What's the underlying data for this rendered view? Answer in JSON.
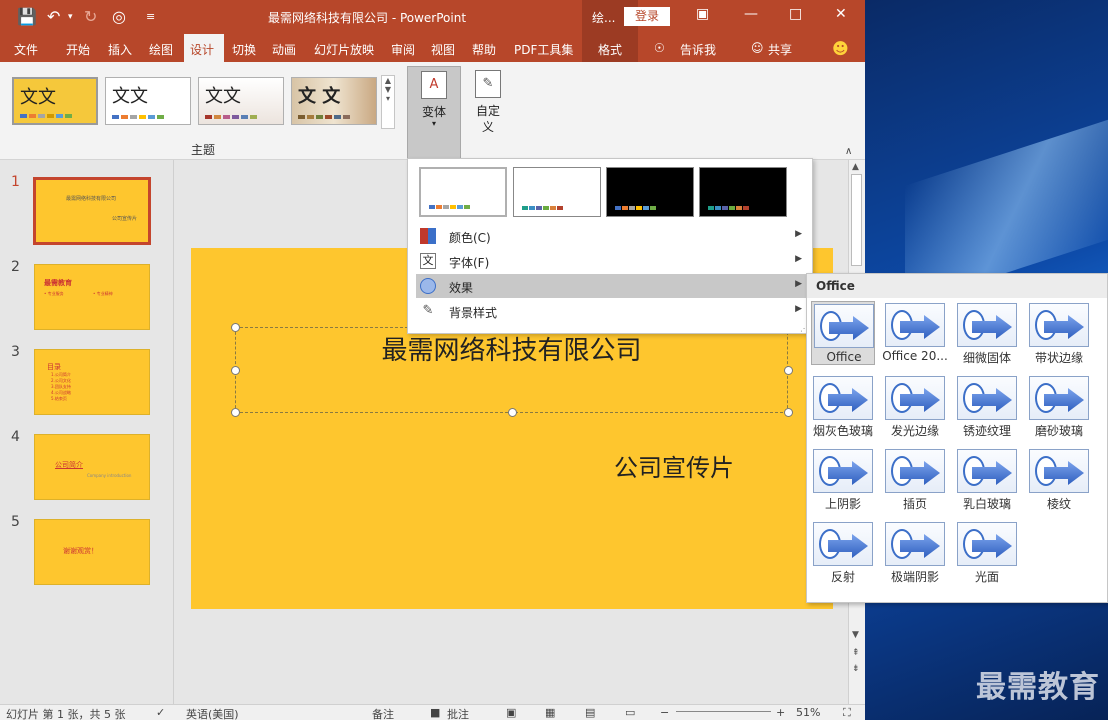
{
  "window": {
    "title": "最需网络科技有限公司  -  PowerPoint",
    "contextual_group": "绘...",
    "login": "登录"
  },
  "tabs": {
    "file": "文件",
    "home": "开始",
    "insert": "插入",
    "draw": "绘图",
    "design": "设计",
    "transitions": "切换",
    "animations": "动画",
    "slideshow": "幻灯片放映",
    "review": "审阅",
    "view": "视图",
    "help": "帮助",
    "pdf": "PDF工具集",
    "format": "格式",
    "tellme": "告诉我",
    "share": "共享"
  },
  "ribbon": {
    "theme_sample": "文文",
    "theme_sample_4": "文 文",
    "group_label": "主题",
    "variant_label": "变体",
    "custom_label_1": "自定",
    "custom_label_2": "义"
  },
  "slides": [
    {
      "num": "1",
      "title": "最需网络科技有限公司",
      "sub": "公司宣传片"
    },
    {
      "num": "2",
      "title": "最需教育",
      "sub": ""
    },
    {
      "num": "3",
      "title": "目录",
      "sub": ""
    },
    {
      "num": "4",
      "title": "公司简介",
      "sub": "Company  introduction"
    },
    {
      "num": "5",
      "title": "谢谢观赏！",
      "sub": ""
    }
  ],
  "slide": {
    "title": "最需网络科技有限公司",
    "subtitle": "公司宣传片"
  },
  "variant_menu": {
    "colors": "颜色(C)",
    "fonts": "字体(F)",
    "effects": "效果",
    "background": "背景样式"
  },
  "effects_menu": {
    "header": "Office",
    "items": [
      "Office",
      "Office 20...",
      "细微固体",
      "带状边缘",
      "烟灰色玻璃",
      "发光边缘",
      "锈迹纹理",
      "磨砂玻璃",
      "上阴影",
      "插页",
      "乳白玻璃",
      "棱纹",
      "反射",
      "极端阴影",
      "光面"
    ]
  },
  "status": {
    "slide_info": "幻灯片 第 1 张，共 5 张",
    "language": "英语(美国)",
    "notes": "备注",
    "comments": "批注",
    "zoom": "51%"
  },
  "watermark": "最需教育",
  "colors": {
    "accent": "#b7472a",
    "slide_bg": "#fec62e",
    "theme_bars": [
      "#4472c4",
      "#ed7d31",
      "#a5a5a5",
      "#ffc000",
      "#5b9bd5",
      "#70ad47"
    ]
  }
}
